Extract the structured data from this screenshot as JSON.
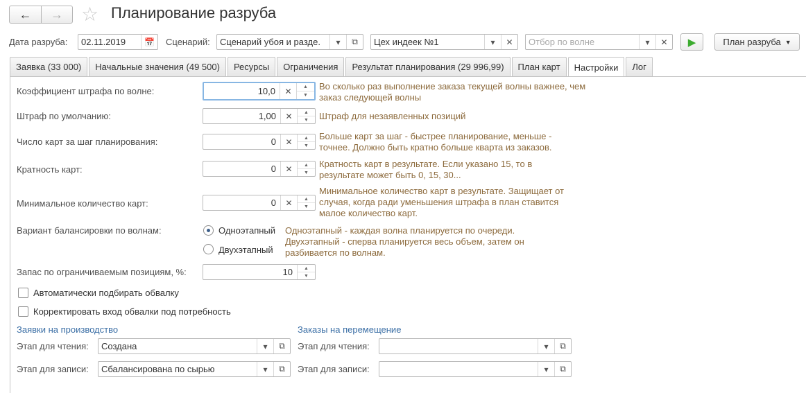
{
  "window": {
    "title": "Планирование разруба"
  },
  "toolbar": {
    "date_label": "Дата разруба:",
    "date_value": "02.11.2019",
    "scenario_label": "Сценарий:",
    "scenario_value": "Сценарий убоя и разде.",
    "workshop_value": "Цех индеек №1",
    "wave_placeholder": "Отбор по волне",
    "plan_button": "План разруба"
  },
  "tabs": [
    {
      "label": "Заявка (33 000)"
    },
    {
      "label": "Начальные значения (49 500)"
    },
    {
      "label": "Ресурсы"
    },
    {
      "label": "Ограничения"
    },
    {
      "label": "Результат планирования (29 996,99)"
    },
    {
      "label": "План карт"
    },
    {
      "label": "Настройки"
    },
    {
      "label": "Лог"
    }
  ],
  "settings": {
    "penalty_coef": {
      "label": "Коэффициент штрафа по волне:",
      "value": "10,0",
      "hint": "Во сколько раз выполнение заказа текущей волны важнее, чем заказ следующей волны"
    },
    "default_penalty": {
      "label": "Штраф по умолчанию:",
      "value": "1,00",
      "hint": "Штраф для незаявленных позиций"
    },
    "cards_per_step": {
      "label": "Число карт за шаг планирования:",
      "value": "0",
      "hint": "Больше карт за шаг - быстрее планирование, меньше - точнее. Должно быть кратно больше кварта из заказов."
    },
    "card_multiplicity": {
      "label": "Кратность карт:",
      "value": "0",
      "hint": "Кратность карт в результате. Если указано 15, то в результате может быть 0, 15, 30..."
    },
    "min_cards": {
      "label": "Минимальное количество карт:",
      "value": "0",
      "hint": "Минимальное количество карт в результате. Защищает от случая, когда ради уменьшения штрафа в план ставится малое количество карт."
    },
    "balancing": {
      "label": "Вариант балансировки по волнам:",
      "option1": "Одноэтапный",
      "option2": "Двухэтапный",
      "hint": "Одноэтапный - каждая волна планируется по очереди. Двухэтапный - сперва планируется весь объем, затем он разбивается по волнам."
    },
    "reserve": {
      "label": "Запас по ограничиваемым позициям, %:",
      "value": "10"
    },
    "auto_coating": {
      "label": "Автоматически подбирать обвалку"
    },
    "correct_coating": {
      "label": "Корректировать вход обвалки под потребность"
    }
  },
  "production_orders": {
    "title": "Заявки на производство",
    "read_label": "Этап для чтения:",
    "read_value": "Создана",
    "write_label": "Этап для записи:",
    "write_value": "Сбалансирована по сырью"
  },
  "transfer_orders": {
    "title": "Заказы на перемещение",
    "read_label": "Этап для чтения:",
    "read_value": "",
    "write_label": "Этап для записи:",
    "write_value": ""
  },
  "colors": {
    "accent_green": "#3cab2f",
    "hint_text": "#8c6a3c",
    "section_link": "#3a6ea5"
  }
}
